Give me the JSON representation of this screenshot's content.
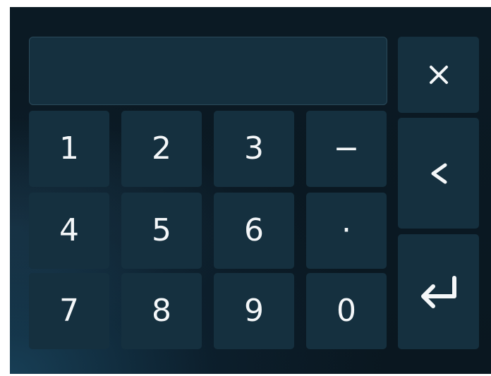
{
  "display": {
    "value": ""
  },
  "keys": {
    "k1": "1",
    "k2": "2",
    "k3": "3",
    "minus": "−",
    "k4": "4",
    "k5": "5",
    "k6": "6",
    "dot": "·",
    "k7": "7",
    "k8": "8",
    "k9": "9",
    "k0": "0"
  },
  "icons": {
    "clear": "close-icon",
    "backspace": "chevron-left-icon",
    "enter": "enter-icon"
  },
  "colors": {
    "background": "#0b1a24",
    "key": "#15303f",
    "text": "#f4f7f9"
  }
}
